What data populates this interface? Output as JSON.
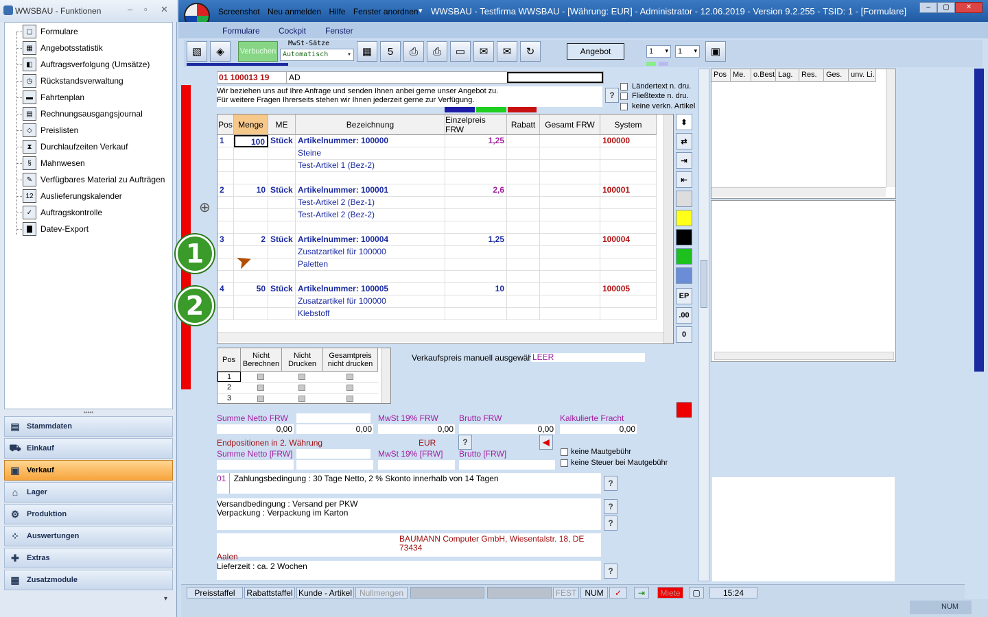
{
  "left_panel": {
    "title": "WWSBAU - Funktionen",
    "tree": [
      {
        "label": "Formulare",
        "icon": "document-icon",
        "glyph": "▢"
      },
      {
        "label": "Angebotsstatistik",
        "icon": "calendar-icon",
        "glyph": "▦"
      },
      {
        "label": "Auftragsverfolgung (Umsätze)",
        "icon": "chart-icon",
        "glyph": "◧"
      },
      {
        "label": "Rückstandsverwaltung",
        "icon": "clock-icon",
        "glyph": "◷"
      },
      {
        "label": "Fahrtenplan",
        "icon": "truck-icon",
        "glyph": "▬"
      },
      {
        "label": "Rechnungsausgangsjournal",
        "icon": "journal-icon",
        "glyph": "▤"
      },
      {
        "label": "Preislisten",
        "icon": "tag-icon",
        "glyph": "◇"
      },
      {
        "label": "Durchlaufzeiten Verkauf",
        "icon": "hourglass-icon",
        "glyph": "⧗"
      },
      {
        "label": "Mahnwesen",
        "icon": "section-icon",
        "glyph": "§"
      },
      {
        "label": "Verfügbares Material zu Aufträgen",
        "icon": "pen-icon",
        "glyph": "✎"
      },
      {
        "label": "Auslieferungskalender",
        "icon": "calendar-12-icon",
        "glyph": "12"
      },
      {
        "label": "Auftragskontrolle",
        "icon": "clipboard-icon",
        "glyph": "✓"
      },
      {
        "label": "Datev-Export",
        "icon": "datev-icon",
        "glyph": "▇"
      }
    ],
    "nav": [
      {
        "label": "Stammdaten",
        "icon": "stammdaten-icon",
        "glyph": "▤",
        "active": false
      },
      {
        "label": "Einkauf",
        "icon": "cart-icon",
        "glyph": "⛟",
        "active": false
      },
      {
        "label": "Verkauf",
        "icon": "register-icon",
        "glyph": "▣",
        "active": true
      },
      {
        "label": "Lager",
        "icon": "warehouse-icon",
        "glyph": "⌂",
        "active": false
      },
      {
        "label": "Produktion",
        "icon": "production-icon",
        "glyph": "⚙",
        "active": false
      },
      {
        "label": "Auswertungen",
        "icon": "analysis-icon",
        "glyph": "⁘",
        "active": false
      },
      {
        "label": "Extras",
        "icon": "extras-icon",
        "glyph": "✚",
        "active": false
      },
      {
        "label": "Zusatzmodule",
        "icon": "modules-icon",
        "glyph": "▦",
        "active": false
      }
    ]
  },
  "main": {
    "menu": [
      "Screenshot",
      "Neu anmelden",
      "Hilfe",
      "Fenster anordnen"
    ],
    "title": "WWSBAU - Testfirma WWSBAU - [Währung: EUR] - Administrator - 12.06.2019 - Version 9.2.255 - TSID: 1 - [Formulare]",
    "submenu": [
      "Formulare",
      "Cockpit",
      "Fenster"
    ],
    "toolbar": {
      "verbuchen": "Verbuchen",
      "mwst_label": "MwSt-Sätze",
      "mwst_value": "Automatisch",
      "angebot": "Angebot",
      "sel1": "1",
      "sel2": "1"
    },
    "address": {
      "number": "01 100013 19",
      "code": "AD"
    },
    "intro": [
      "Wir beziehen uns auf Ihre Anfrage und senden Ihnen anbei gerne unser Angebot zu.",
      "Für weitere Fragen Ihrerseits stehen wir Ihnen jederzeit gerne zur Verfügung."
    ],
    "checkboxes": [
      "Ländertext  n. dru.",
      "Fließtexte n. dru.",
      "keine verkn. Artikel"
    ],
    "grid": {
      "headers": [
        "Pos",
        "Menge",
        "ME",
        "Bezeichnung",
        "Einzelpreis FRW",
        "Rabatt",
        "Gesamt FRW",
        "System"
      ],
      "rows": [
        {
          "pos": "1",
          "menge": "100",
          "me": "Stück",
          "bez": "Artikelnummer: 100000",
          "ep": "1,25",
          "sys": "100000",
          "kind": "art",
          "epc": "ep"
        },
        {
          "bez": "Steine",
          "kind": "desc"
        },
        {
          "bez": "Test-Artikel 1  (Bez-2)",
          "kind": "desc"
        },
        {
          "kind": "blank"
        },
        {
          "pos": "2",
          "menge": "10",
          "me": "Stück",
          "bez": "Artikelnummer: 100001",
          "ep": "2,6",
          "sys": "100001",
          "kind": "art",
          "epc": "ep"
        },
        {
          "bez": "Test-Artikel 2  (Bez-1)",
          "kind": "desc"
        },
        {
          "bez": "Test-Artikel 2  (Bez-2)",
          "kind": "desc"
        },
        {
          "kind": "blank"
        },
        {
          "pos": "3",
          "menge": "2",
          "me": "Stück",
          "bez": "Artikelnummer: 100004",
          "ep": "1,25",
          "sys": "100004",
          "kind": "art",
          "epc": "ep2"
        },
        {
          "bez": "Zusatzartikel für 100000",
          "kind": "desc"
        },
        {
          "bez": "Paletten",
          "kind": "desc"
        },
        {
          "kind": "blank"
        },
        {
          "pos": "4",
          "menge": "50",
          "me": "Stück",
          "bez": "Artikelnummer: 100005",
          "ep": "10",
          "sys": "100005",
          "kind": "art",
          "epc": "ep2"
        },
        {
          "bez": "Zusatzartikel für 100000",
          "kind": "desc"
        },
        {
          "bez": "Klebstoff",
          "kind": "desc"
        }
      ]
    },
    "right_tools": [
      "EP",
      ".00",
      "0"
    ],
    "small_grid": {
      "headers": [
        "Pos",
        "Nicht Berechnen",
        "Nicht Drucken",
        "Gesamtpreis nicht drucken"
      ],
      "rows": [
        "1",
        "2",
        "3"
      ]
    },
    "vk_label": "Verkaufspreis manuell ausgewählt:",
    "vk_value": "LEER",
    "totals": {
      "summe_netto": "Summe Netto FRW",
      "mwst": "MwSt 19% FRW",
      "brutto": "Brutto FRW",
      "fracht": "Kalkulierte Fracht",
      "v1": "0,00",
      "v2": "0,00",
      "v3": "0,00",
      "v4": "0,00",
      "v5": "0,00",
      "endpos": "Endpositionen in 2. Währung",
      "eur": "EUR",
      "summe_netto2": "Summe Netto [FRW]",
      "mwst2": "MwSt 19% [FRW]",
      "brutto2": "Brutto [FRW]",
      "maut1": "keine Mautgebühr",
      "maut2": "keine Steuer bei Mautgebühr"
    },
    "zahlung": {
      "code": "01",
      "text": "Zahlungsbedingung : 30 Tage Netto, 2 % Skonto innerhalb von 14 Tagen"
    },
    "versand": [
      "Versandbedingung : Versand per PKW",
      "Verpackung :  Verpackung im Karton"
    ],
    "footer_addr": "BAUMANN Computer GmbH, Wiesentalstr. 18, DE 73434",
    "footer_city": "Aalen",
    "lieferzeit": "Lieferzeit : ca. 2 Wochen",
    "right_grid_headers": [
      "Pos",
      "Me.",
      "o.Best",
      "Lag.",
      "Res.",
      "Ges.",
      "unv. Li."
    ],
    "status": {
      "preisstaffel": "Preisstaffel",
      "rabattstaffel": "Rabattstaffel",
      "kunde": "Kunde - Artikel",
      "nullmengen": "Nullmengen",
      "fest": "FEST",
      "num": "NUM",
      "miete": "Miete",
      "time": "15:24"
    },
    "bottom_num": "NUM"
  },
  "callouts": [
    "1",
    "2"
  ]
}
